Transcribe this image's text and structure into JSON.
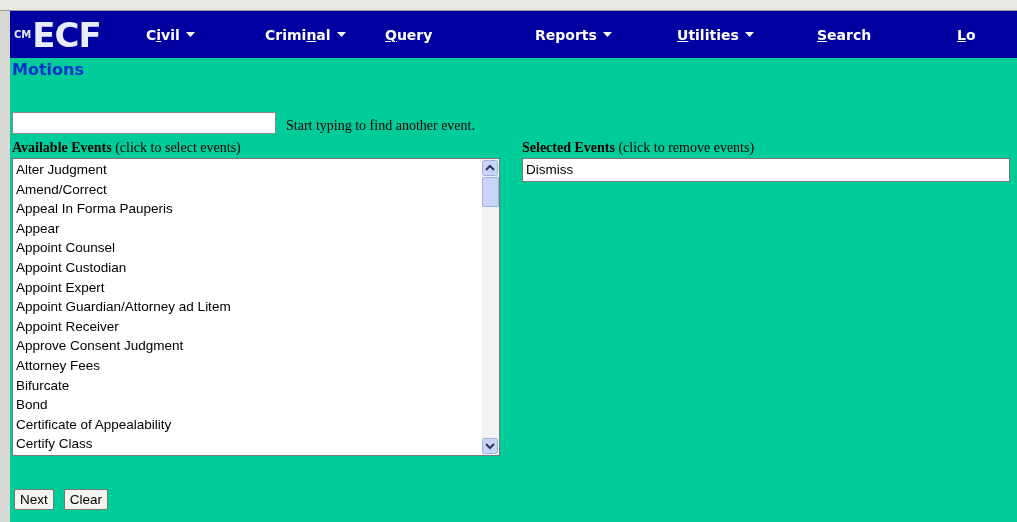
{
  "logo": {
    "small": "CM",
    "large": "ECF"
  },
  "menu": [
    {
      "pre": "C",
      "key": "i",
      "post": "vil",
      "dropdown": true
    },
    {
      "pre": "Crimi",
      "key": "n",
      "post": "al",
      "dropdown": true
    },
    {
      "key": "Q",
      "post": "uery",
      "dropdown": false
    },
    {
      "pre": "Reports",
      "dropdown": true
    },
    {
      "key": "U",
      "post": "tilities",
      "dropdown": true
    },
    {
      "key": "S",
      "post": "earch",
      "dropdown": false
    },
    {
      "key": "L",
      "post": "o",
      "dropdown": false
    }
  ],
  "page_title": "Motions",
  "search": {
    "hint": "Start typing to find another event."
  },
  "available": {
    "heading": "Available Events",
    "note": "(click to select events)",
    "items": [
      "Alter Judgment",
      "Amend/Correct",
      "Appeal In Forma Pauperis",
      "Appear",
      "Appoint Counsel",
      "Appoint Custodian",
      "Appoint Expert",
      "Appoint Guardian/Attorney ad Litem",
      "Appoint Receiver",
      "Approve Consent Judgment",
      "Attorney Fees",
      "Bifurcate",
      "Bond",
      "Certificate of Appealability",
      "Certify Class"
    ]
  },
  "selected": {
    "heading": "Selected Events",
    "note": "(click to remove events)",
    "items": [
      "Dismiss"
    ]
  },
  "buttons": [
    "Next",
    "Clear"
  ]
}
